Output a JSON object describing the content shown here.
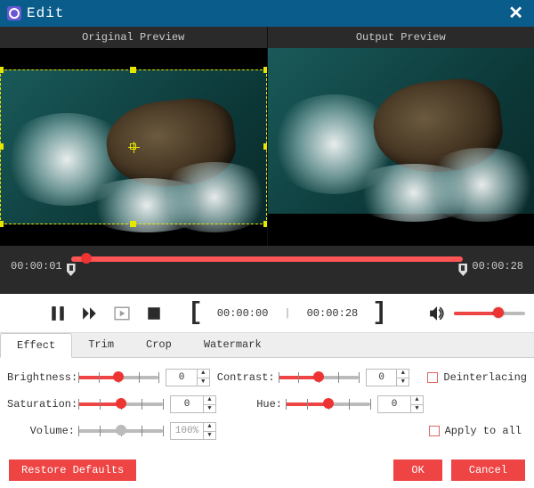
{
  "title": "Edit",
  "close_glyph": "✕",
  "preview": {
    "original_label": "Original Preview",
    "output_label": "Output Preview"
  },
  "timeline": {
    "current": "00:00:01",
    "total": "00:00:28",
    "playhead_pct": 4,
    "trim_start_pct": 0,
    "trim_end_pct": 100
  },
  "transport": {
    "range_start": "00:00:00",
    "range_end": "00:00:28",
    "volume_pct": 62
  },
  "tabs": [
    {
      "label": "Effect",
      "active": true
    },
    {
      "label": "Trim",
      "active": false
    },
    {
      "label": "Crop",
      "active": false
    },
    {
      "label": "Watermark",
      "active": false
    }
  ],
  "effect": {
    "brightness": {
      "label": "Brightness:",
      "value": "0",
      "slider_pct": 50
    },
    "contrast": {
      "label": "Contrast:",
      "value": "0",
      "slider_pct": 50
    },
    "saturation": {
      "label": "Saturation:",
      "value": "0",
      "slider_pct": 50
    },
    "hue": {
      "label": "Hue:",
      "value": "0",
      "slider_pct": 50
    },
    "volume": {
      "label": "Volume:",
      "value": "100%",
      "slider_pct": 50
    },
    "deinterlacing_label": "Deinterlacing",
    "apply_all_label": "Apply to all"
  },
  "footer": {
    "restore": "Restore Defaults",
    "ok": "OK",
    "cancel": "Cancel"
  }
}
